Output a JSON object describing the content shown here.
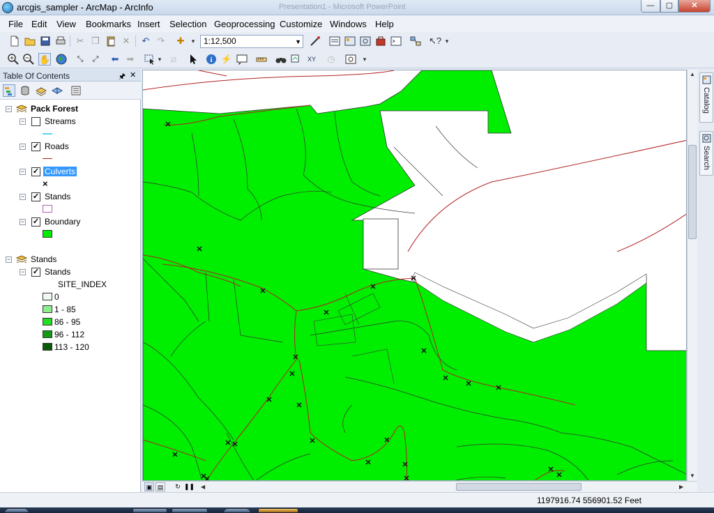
{
  "window": {
    "title": "arcgis_sampler - ArcMap - ArcInfo",
    "background_window_title": "Presentation1 - Microsoft PowerPoint",
    "controls": {
      "minimize": "—",
      "maximize": "▢",
      "close": "✕"
    }
  },
  "menu": [
    "File",
    "Edit",
    "View",
    "Bookmarks",
    "Insert",
    "Selection",
    "Geoprocessing",
    "Customize",
    "Windows",
    "Help"
  ],
  "toolbar": {
    "scale": "1:12,500"
  },
  "toc": {
    "header": "Table Of Contents",
    "groups": [
      {
        "name": "Pack Forest",
        "layers": [
          {
            "name": "Streams",
            "checked": false
          },
          {
            "name": "Roads",
            "checked": true
          },
          {
            "name": "Culverts",
            "checked": true,
            "selected": true,
            "symbol": "×"
          },
          {
            "name": "Stands",
            "checked": true
          },
          {
            "name": "Boundary",
            "checked": true
          }
        ]
      },
      {
        "name": "Stands",
        "layers": [
          {
            "name": "Stands",
            "checked": true,
            "field": "SITE_INDEX",
            "classes": [
              {
                "label": "0",
                "color": "#f0fbf0"
              },
              {
                "label": "1 - 85",
                "color": "#8fef8f"
              },
              {
                "label": "86 - 95",
                "color": "#22dd22"
              },
              {
                "label": "96 - 112",
                "color": "#149a14"
              },
              {
                "label": "113 - 120",
                "color": "#0a5a0a"
              }
            ]
          }
        ]
      }
    ]
  },
  "dock": {
    "catalog": "Catalog",
    "search": "Search"
  },
  "status": {
    "coordinates": "1197916.74  556901.52 Feet"
  },
  "colors": {
    "forest_green": "#00ee00",
    "road_red": "#b22222",
    "stream_cyan": "#5ad6f0",
    "selection_blue": "#3399ff"
  }
}
